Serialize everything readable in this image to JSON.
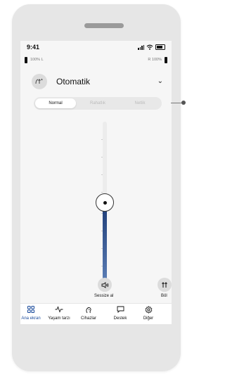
{
  "status": {
    "time": "9:41"
  },
  "batteries": {
    "left_text": "100% L",
    "right_text": "R 100%"
  },
  "program": {
    "icon": "auto-program-icon",
    "name": "Otomatik"
  },
  "modes": [
    {
      "label": "Normal",
      "active": true
    },
    {
      "label": "Rahatlık",
      "active": false
    },
    {
      "label": "Netlik",
      "active": false
    }
  ],
  "volume": {
    "level_fraction": 0.5
  },
  "actions": {
    "mute_label": "Sessize al",
    "split_label": "Böl"
  },
  "tabs": [
    {
      "label": "Ana ekran",
      "icon": "grid-icon",
      "active": true
    },
    {
      "label": "Yaşam tarzı",
      "icon": "activity-icon",
      "active": false
    },
    {
      "label": "Cihazlar",
      "icon": "hearing-aid-icon",
      "active": false
    },
    {
      "label": "Destek",
      "icon": "chat-icon",
      "active": false
    },
    {
      "label": "Diğer",
      "icon": "gear-icon",
      "active": false
    }
  ],
  "colors": {
    "accent": "#1a4a9b",
    "slider_dark": "#1d3b76",
    "slider_light": "#5c7fb6"
  }
}
